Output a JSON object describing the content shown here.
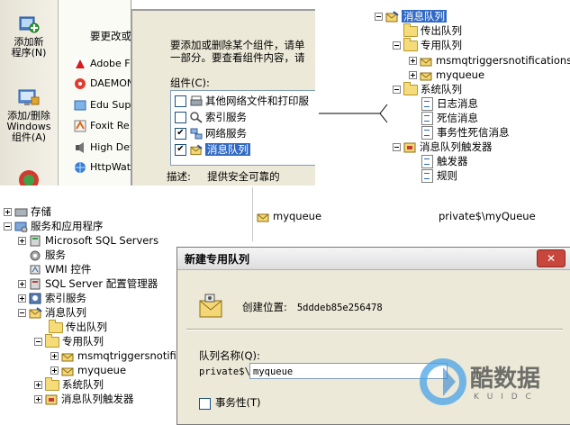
{
  "panel1": {
    "side_buttons": [
      {
        "label_line1": "添加新",
        "label_line2": "程序(N)",
        "label_line3": ""
      },
      {
        "label_line1": "添加/删除",
        "label_line2": "Windows",
        "label_line3": "组件(A)"
      }
    ],
    "header_text": "要更改或",
    "programs": [
      {
        "name": "Adobe F",
        "icon": "adobe-icon"
      },
      {
        "name": "DAEMON",
        "icon": "daemon-icon"
      },
      {
        "name": "Edu Supp",
        "icon": "edu-icon"
      },
      {
        "name": "Foxit Re",
        "icon": "foxit-icon"
      },
      {
        "name": "High Def",
        "icon": "audio-icon"
      },
      {
        "name": "HttpWat",
        "icon": "httpwatch-icon"
      }
    ],
    "dialog": {
      "intro_line1": "要添加或删除某个组件，请单",
      "intro_line2": "一部分。要查看组件内容，请",
      "components_label": "组件(C):",
      "components": [
        {
          "label": "其他网络文件和打印服",
          "checked": false,
          "icon": "printer-icon"
        },
        {
          "label": "索引服务",
          "checked": false,
          "icon": "index-icon"
        },
        {
          "label": "网络服务",
          "checked": true,
          "icon": "network-icon"
        },
        {
          "label": "消息队列",
          "checked": true,
          "icon": "mq-icon",
          "selected": true
        }
      ],
      "desc_label": "描述:",
      "desc_text": "提供安全可靠的"
    }
  },
  "panel2": {
    "nodes": [
      {
        "label": "消息队列",
        "level": 0,
        "expander": "minus",
        "icon": "mq-icon",
        "selected": true
      },
      {
        "label": "传出队列",
        "level": 1,
        "expander": "none",
        "icon": "folder-icon"
      },
      {
        "label": "专用队列",
        "level": 1,
        "expander": "minus",
        "icon": "folder-icon"
      },
      {
        "label": "msmqtriggersnotifications",
        "level": 2,
        "expander": "plus",
        "icon": "queue-icon"
      },
      {
        "label": "myqueue",
        "level": 2,
        "expander": "plus",
        "icon": "queue-icon"
      },
      {
        "label": "系统队列",
        "level": 1,
        "expander": "minus",
        "icon": "folder-icon"
      },
      {
        "label": "日志消息",
        "level": 2,
        "expander": "none",
        "icon": "doc-icon"
      },
      {
        "label": "死信消息",
        "level": 2,
        "expander": "none",
        "icon": "doc-icon"
      },
      {
        "label": "事务性死信消息",
        "level": 2,
        "expander": "none",
        "icon": "doc-icon"
      },
      {
        "label": "消息队列触发器",
        "level": 1,
        "expander": "minus",
        "icon": "trigger-icon"
      },
      {
        "label": "触发器",
        "level": 2,
        "expander": "none",
        "icon": "doc-icon"
      },
      {
        "label": "规则",
        "level": 2,
        "expander": "none",
        "icon": "doc-icon"
      }
    ]
  },
  "panel3": {
    "nodes": [
      {
        "label": "存储",
        "level": 0,
        "expander": "plus",
        "icon": "storage-icon"
      },
      {
        "label": "服务和应用程序",
        "level": 0,
        "expander": "minus",
        "icon": "services-icon"
      },
      {
        "label": "Microsoft SQL Servers",
        "level": 1,
        "expander": "plus",
        "icon": "sql-icon"
      },
      {
        "label": "服务",
        "level": 1,
        "expander": "none",
        "icon": "gear-icon"
      },
      {
        "label": "WMI 控件",
        "level": 1,
        "expander": "none",
        "icon": "wmi-icon"
      },
      {
        "label": "SQL Server 配置管理器",
        "level": 1,
        "expander": "plus",
        "icon": "sql-icon"
      },
      {
        "label": "索引服务",
        "level": 1,
        "expander": "plus",
        "icon": "index-icon"
      },
      {
        "label": "消息队列",
        "level": 1,
        "expander": "minus",
        "icon": "mq-icon"
      },
      {
        "label": "传出队列",
        "level": 2,
        "expander": "none",
        "icon": "folder-icon"
      },
      {
        "label": "专用队列",
        "level": 2,
        "expander": "minus",
        "icon": "folder-icon"
      },
      {
        "label": "msmqtriggersnotificat",
        "level": 3,
        "expander": "plus",
        "icon": "queue-icon"
      },
      {
        "label": "myqueue",
        "level": 3,
        "expander": "plus",
        "icon": "queue-icon"
      },
      {
        "label": "系统队列",
        "level": 2,
        "expander": "plus",
        "icon": "folder-icon"
      },
      {
        "label": "消息队列触发器",
        "level": 2,
        "expander": "plus",
        "icon": "trigger-icon"
      }
    ]
  },
  "panel4": {
    "list_row": {
      "name": "myqueue",
      "path": "private$\\myQueue"
    },
    "dialog": {
      "title": "新建专用队列",
      "close": "✕",
      "created_label": "创建位置:",
      "created_value": "5dddeb85e256478",
      "queue_name_label": "队列名称(Q):",
      "prefix": "private$\\",
      "queue_name_value": "myqueue",
      "transactional_label": "事务性(T)"
    }
  },
  "watermark": {
    "brand": "酷数据",
    "sub": "K U I D C"
  }
}
